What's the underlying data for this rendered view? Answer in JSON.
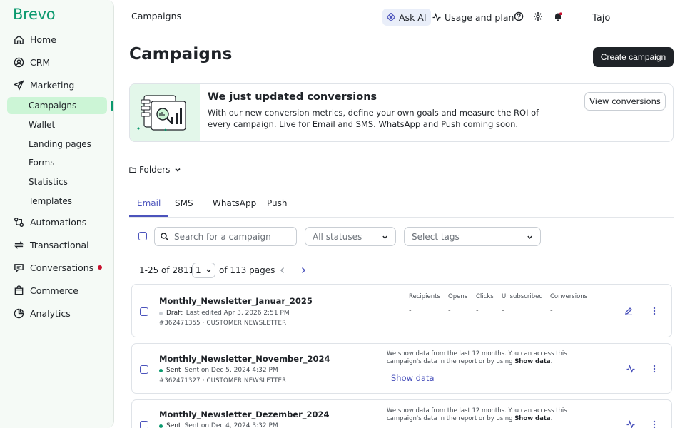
{
  "app": {
    "logo": "Brevo",
    "user": "Tajo"
  },
  "sidebar": {
    "items": [
      {
        "label": "Home",
        "icon": "home-icon"
      },
      {
        "label": "CRM",
        "icon": "contacts-icon"
      },
      {
        "label": "Marketing",
        "icon": "send-icon"
      },
      {
        "label": "Automations",
        "icon": "automation-icon"
      },
      {
        "label": "Transactional",
        "icon": "sync-icon"
      },
      {
        "label": "Conversations",
        "icon": "chat-icon"
      },
      {
        "label": "Commerce",
        "icon": "bag-icon"
      },
      {
        "label": "Analytics",
        "icon": "pie-chart-icon"
      }
    ],
    "marketing_subitems": [
      "Campaigns",
      "Wallet",
      "Landing pages",
      "Forms",
      "Statistics",
      "Templates"
    ],
    "active_subitem": "Campaigns"
  },
  "topbar": {
    "title": "Campaigns",
    "ask_ai": "Ask AI",
    "usage": "Usage and plan"
  },
  "page": {
    "title": "Campaigns",
    "create_button": "Create campaign"
  },
  "banner": {
    "title": "We just updated conversions",
    "text": "With our new conversion metrics, define your own goals and measure the ROI of every campaign. Live for Email and SMS. WhatsApp and Push coming soon.",
    "button": "View conversions"
  },
  "folders": {
    "label": "Folders"
  },
  "tabs": [
    {
      "label": "Email",
      "active": true
    },
    {
      "label": "SMS",
      "active": false
    },
    {
      "label": "WhatsApp",
      "active": false
    },
    {
      "label": "Push",
      "active": false
    }
  ],
  "filters": {
    "search_placeholder": "Search for a campaign",
    "status_select": "All statuses",
    "tags_select": "Select tags"
  },
  "pagination": {
    "range": "1-25 of 2811",
    "current_page": "1",
    "total": "of 113 pages"
  },
  "stat_headers": [
    "Recipients",
    "Opens",
    "Clicks",
    "Unsubscribed",
    "Conversions"
  ],
  "campaigns": [
    {
      "name": "Monthly_Newsletter_Januar_2025",
      "status": "Draft",
      "status_color": "#c9ced4",
      "detail": "Last edited Apr 3, 2026 2:51 PM",
      "id": "#362471355",
      "tag": "· CUSTOMER NEWSLETTER",
      "stats": [
        "-",
        "-",
        "-",
        "-",
        "-"
      ]
    },
    {
      "name": "Monthly_Newsletter_November_2024",
      "status": "Sent",
      "status_color": "#0b996e",
      "detail": "Sent on Dec 5, 2024 4:32 PM",
      "id": "#362471327",
      "tag": "· CUSTOMER NEWSLETTER",
      "note_prefix": "We show data from the last 12 months. You can access this campaign's data in the report or by using",
      "note_bold": "Show data",
      "show_data": "Show data"
    },
    {
      "name": "Monthly_Newsletter_Dezember_2024",
      "status": "Sent",
      "status_color": "#0b996e",
      "detail": "Sent on Dec 4, 2024 3:32 PM",
      "note_prefix": "We show data from the last 12 months. You can access this campaign's data in the report or by using",
      "note_bold": "Show data"
    }
  ],
  "colors": {
    "brand": "#0b996e",
    "accent": "#4b53bc",
    "active_bg": "#ccf5d6",
    "dark_button": "#1f2328"
  }
}
